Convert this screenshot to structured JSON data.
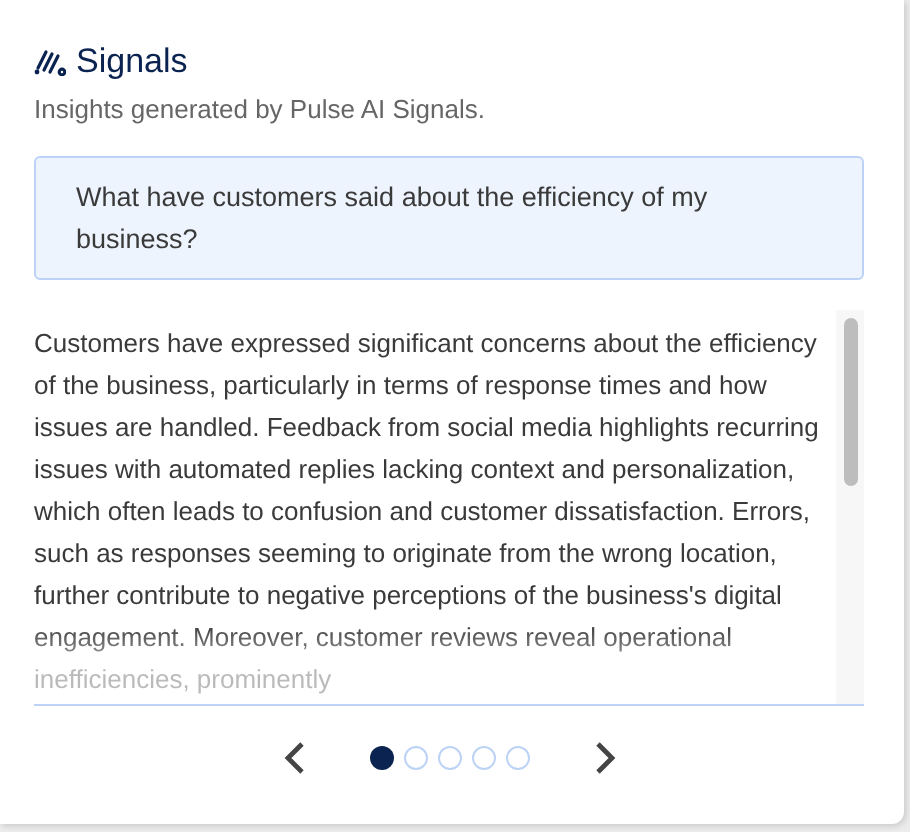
{
  "card": {
    "title": "Signals",
    "subtitle": "Insights generated by Pulse AI Signals."
  },
  "question": "What have customers said about the efficiency of my business?",
  "answer": "Customers have expressed significant concerns about the efficiency of the business, particularly in terms of response times and how issues are handled. Feedback from social media highlights recurring issues with automated replies lacking context and personalization, which often leads to confusion and customer dissatisfaction. Errors, such as responses seeming to originate from the wrong location, further contribute to negative perceptions of the business's digital engagement. Moreover, customer reviews reveal operational inefficiencies, prominently",
  "pager": {
    "dots": [
      {
        "selected": true
      },
      {
        "selected": false
      },
      {
        "selected": false
      },
      {
        "selected": false
      },
      {
        "selected": false
      }
    ]
  }
}
